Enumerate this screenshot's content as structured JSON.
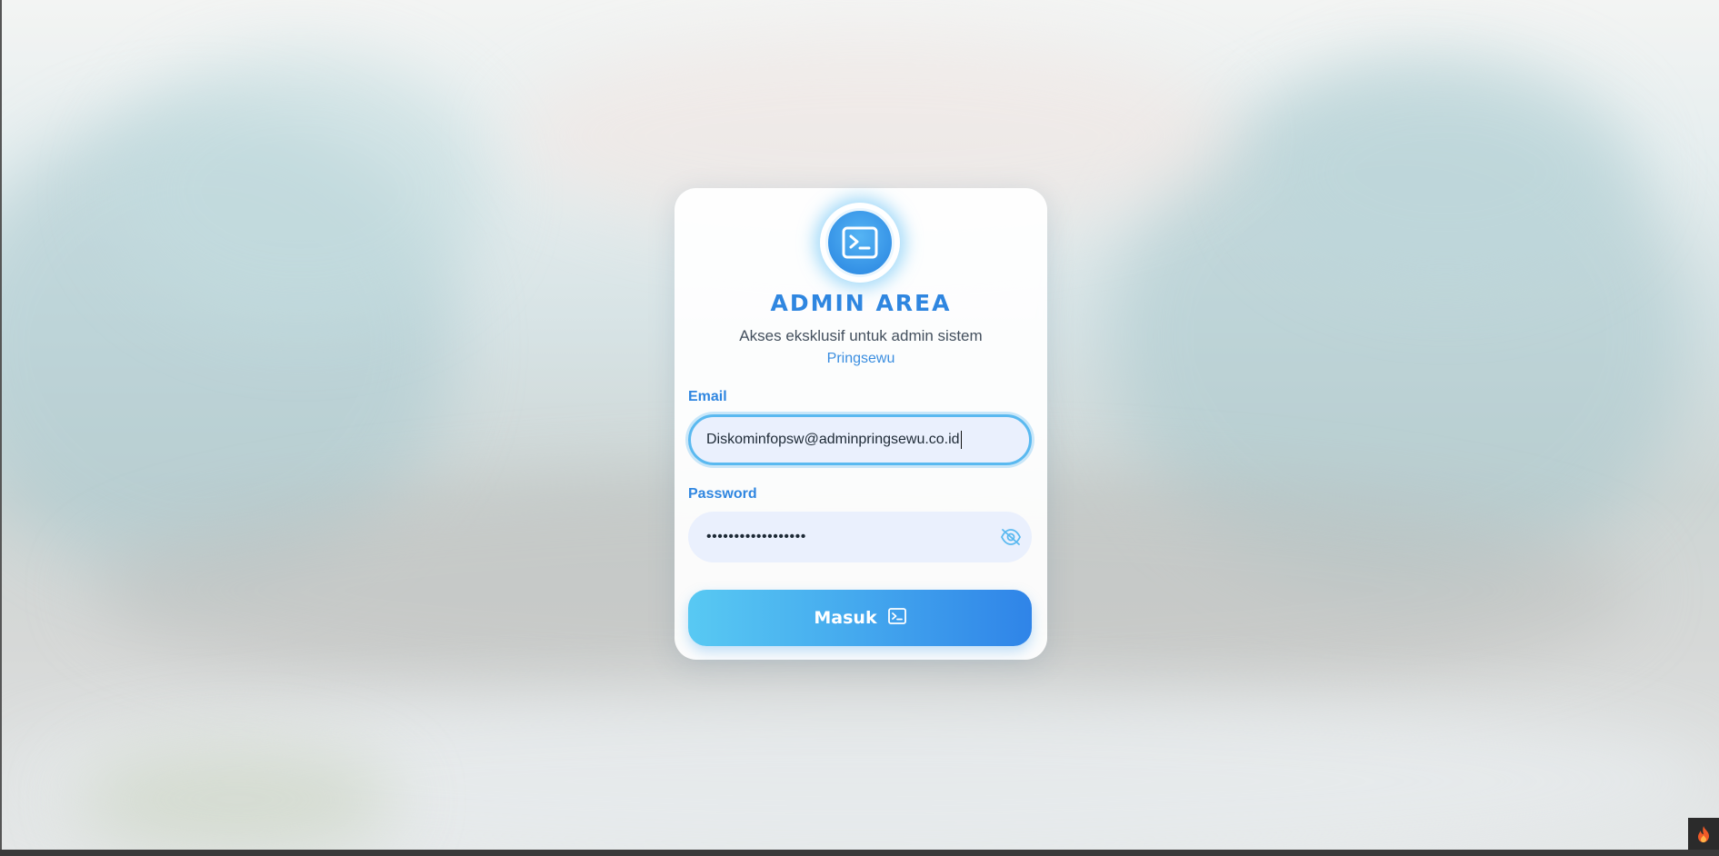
{
  "header": {
    "title": "ADMIN AREA",
    "subtitle": "Akses eksklusif untuk admin sistem",
    "brand": "Pringsewu"
  },
  "form": {
    "email_label": "Email",
    "email_value": "Diskominfopsw@adminpringsewu.co.id",
    "password_label": "Password",
    "password_masked": "••••••••••••••••••",
    "submit_label": "Masuk"
  },
  "icons": {
    "logo": "terminal-icon",
    "password_toggle": "eye-off-icon",
    "submit": "terminal-icon",
    "corner": "flame-icon"
  },
  "colors": {
    "accent": "#2f86e0",
    "accent_light": "#58c9f3",
    "field_bg": "#eaf0fd",
    "focus_border": "#5ab9f0"
  }
}
